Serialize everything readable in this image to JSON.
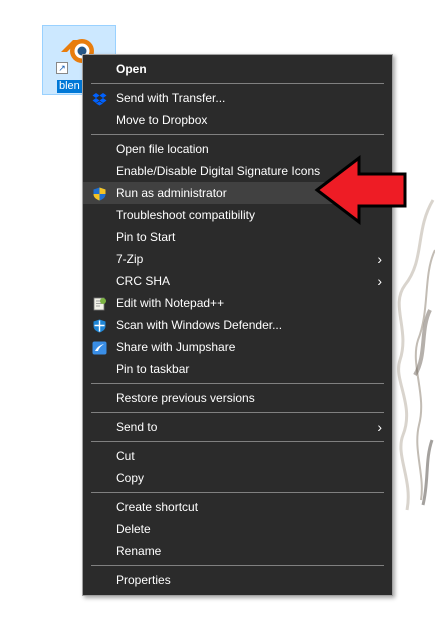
{
  "desktop": {
    "icon_label": "blen"
  },
  "menu": {
    "groups": [
      [
        {
          "label": "Open",
          "bold": true
        }
      ],
      [
        {
          "label": "Send with Transfer...",
          "icon": "dropbox-icon"
        },
        {
          "label": "Move to Dropbox"
        }
      ],
      [
        {
          "label": "Open file location"
        },
        {
          "label": "Enable/Disable Digital Signature Icons"
        },
        {
          "label": "Run as administrator",
          "icon": "uac-shield-icon",
          "highlighted": true
        },
        {
          "label": "Troubleshoot compatibility"
        },
        {
          "label": "Pin to Start"
        },
        {
          "label": "7-Zip",
          "submenu": true
        },
        {
          "label": "CRC SHA",
          "submenu": true
        },
        {
          "label": "Edit with Notepad++",
          "icon": "notepad-plus-plus-icon"
        },
        {
          "label": "Scan with Windows Defender...",
          "icon": "windows-defender-icon"
        },
        {
          "label": "Share with Jumpshare",
          "icon": "jumpshare-icon"
        },
        {
          "label": "Pin to taskbar"
        }
      ],
      [
        {
          "label": "Restore previous versions"
        }
      ],
      [
        {
          "label": "Send to",
          "submenu": true
        }
      ],
      [
        {
          "label": "Cut"
        },
        {
          "label": "Copy"
        }
      ],
      [
        {
          "label": "Create shortcut"
        },
        {
          "label": "Delete"
        },
        {
          "label": "Rename"
        }
      ],
      [
        {
          "label": "Properties"
        }
      ]
    ]
  },
  "annotation": {
    "arrow_color": "#ee1c25",
    "points_to": "Run as administrator"
  }
}
